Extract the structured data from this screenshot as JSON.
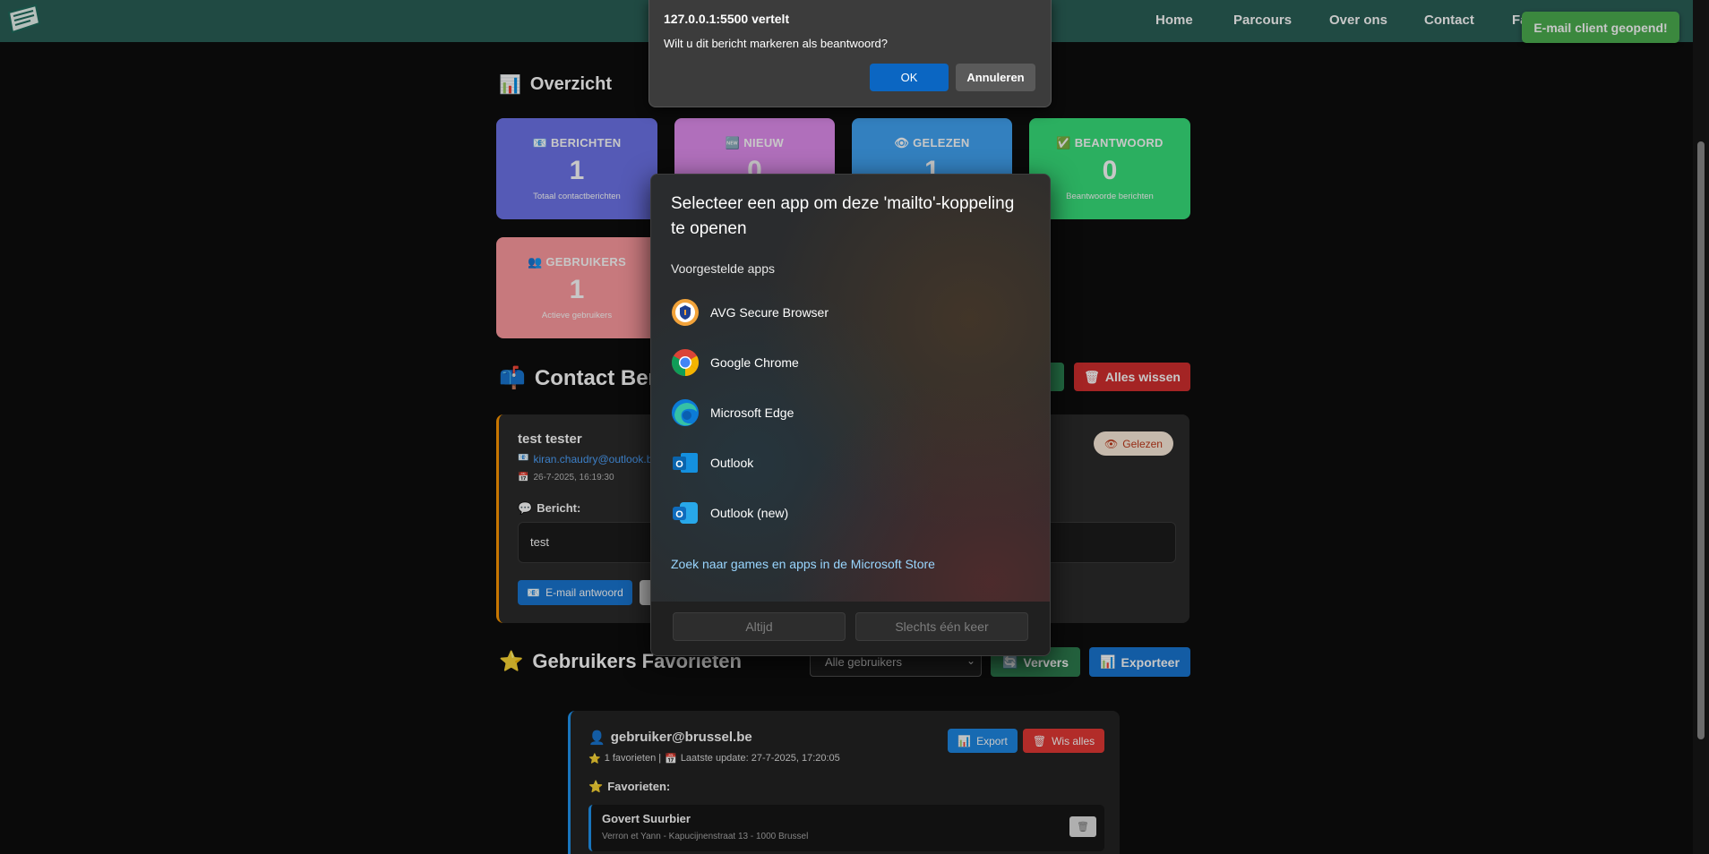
{
  "nav": {
    "links": [
      "Home",
      "Parcours",
      "Over ons",
      "Contact",
      "Fa"
    ]
  },
  "toast": "E-mail client geopend!",
  "overview": {
    "title": "Overzicht",
    "cards": [
      {
        "label": "BERICHTEN",
        "value": "1",
        "sub": "Totaal contactberichten",
        "color": "#6e74ea"
      },
      {
        "label": "NIEUW",
        "value": "0",
        "sub": "",
        "color": "#e28ff0"
      },
      {
        "label": "GELEZEN",
        "value": "1",
        "sub": "",
        "color": "#42a5f5"
      },
      {
        "label": "BEANTWOORD",
        "value": "0",
        "sub": "Beantwoorde berichten",
        "color": "#38e07b"
      },
      {
        "label": "GEBRUIKERS",
        "value": "1",
        "sub": "Actieve gebruikers",
        "color": "#ff9ca1"
      }
    ]
  },
  "contact": {
    "title": "Contact Beri",
    "clear_all": "Alles wissen",
    "message": {
      "name": "test tester",
      "email": "kiran.chaudry@outlook.be",
      "date": "26-7-2025, 16:19:30",
      "label": "Bericht:",
      "body": "test",
      "status": "Gelezen",
      "reply_button": "E-mail antwoord"
    }
  },
  "favorites": {
    "title": "Gebruikers Favorieten",
    "filter_value": "Alle gebruikers",
    "refresh_button": "Ververs",
    "export_button": "Exporteer",
    "user": {
      "email": "gebruiker@brussel.be",
      "meta_count": "1 favorieten |",
      "meta_update": "Laatste update: 27-7-2025, 17:20:05",
      "export_button": "Export",
      "clear_button": "Wis alles",
      "fav_label": "Favorieten:",
      "item": {
        "name": "Govert Suurbier",
        "address": "Verron et Yann - Kapucijnenstraat 13 - 1000 Brussel"
      }
    }
  },
  "alert": {
    "title": "127.0.0.1:5500 vertelt",
    "message": "Wilt u dit bericht markeren als beantwoord?",
    "ok": "OK",
    "cancel": "Annuleren"
  },
  "picker": {
    "title": "Selecteer een app om deze 'mailto'-koppeling te openen",
    "suggested": "Voorgestelde apps",
    "apps": [
      "AVG Secure Browser",
      "Google Chrome",
      "Microsoft Edge",
      "Outlook",
      "Outlook (new)"
    ],
    "store_link": "Zoek naar games en apps in de Microsoft Store",
    "always": "Altijd",
    "once": "Slechts één keer"
  }
}
